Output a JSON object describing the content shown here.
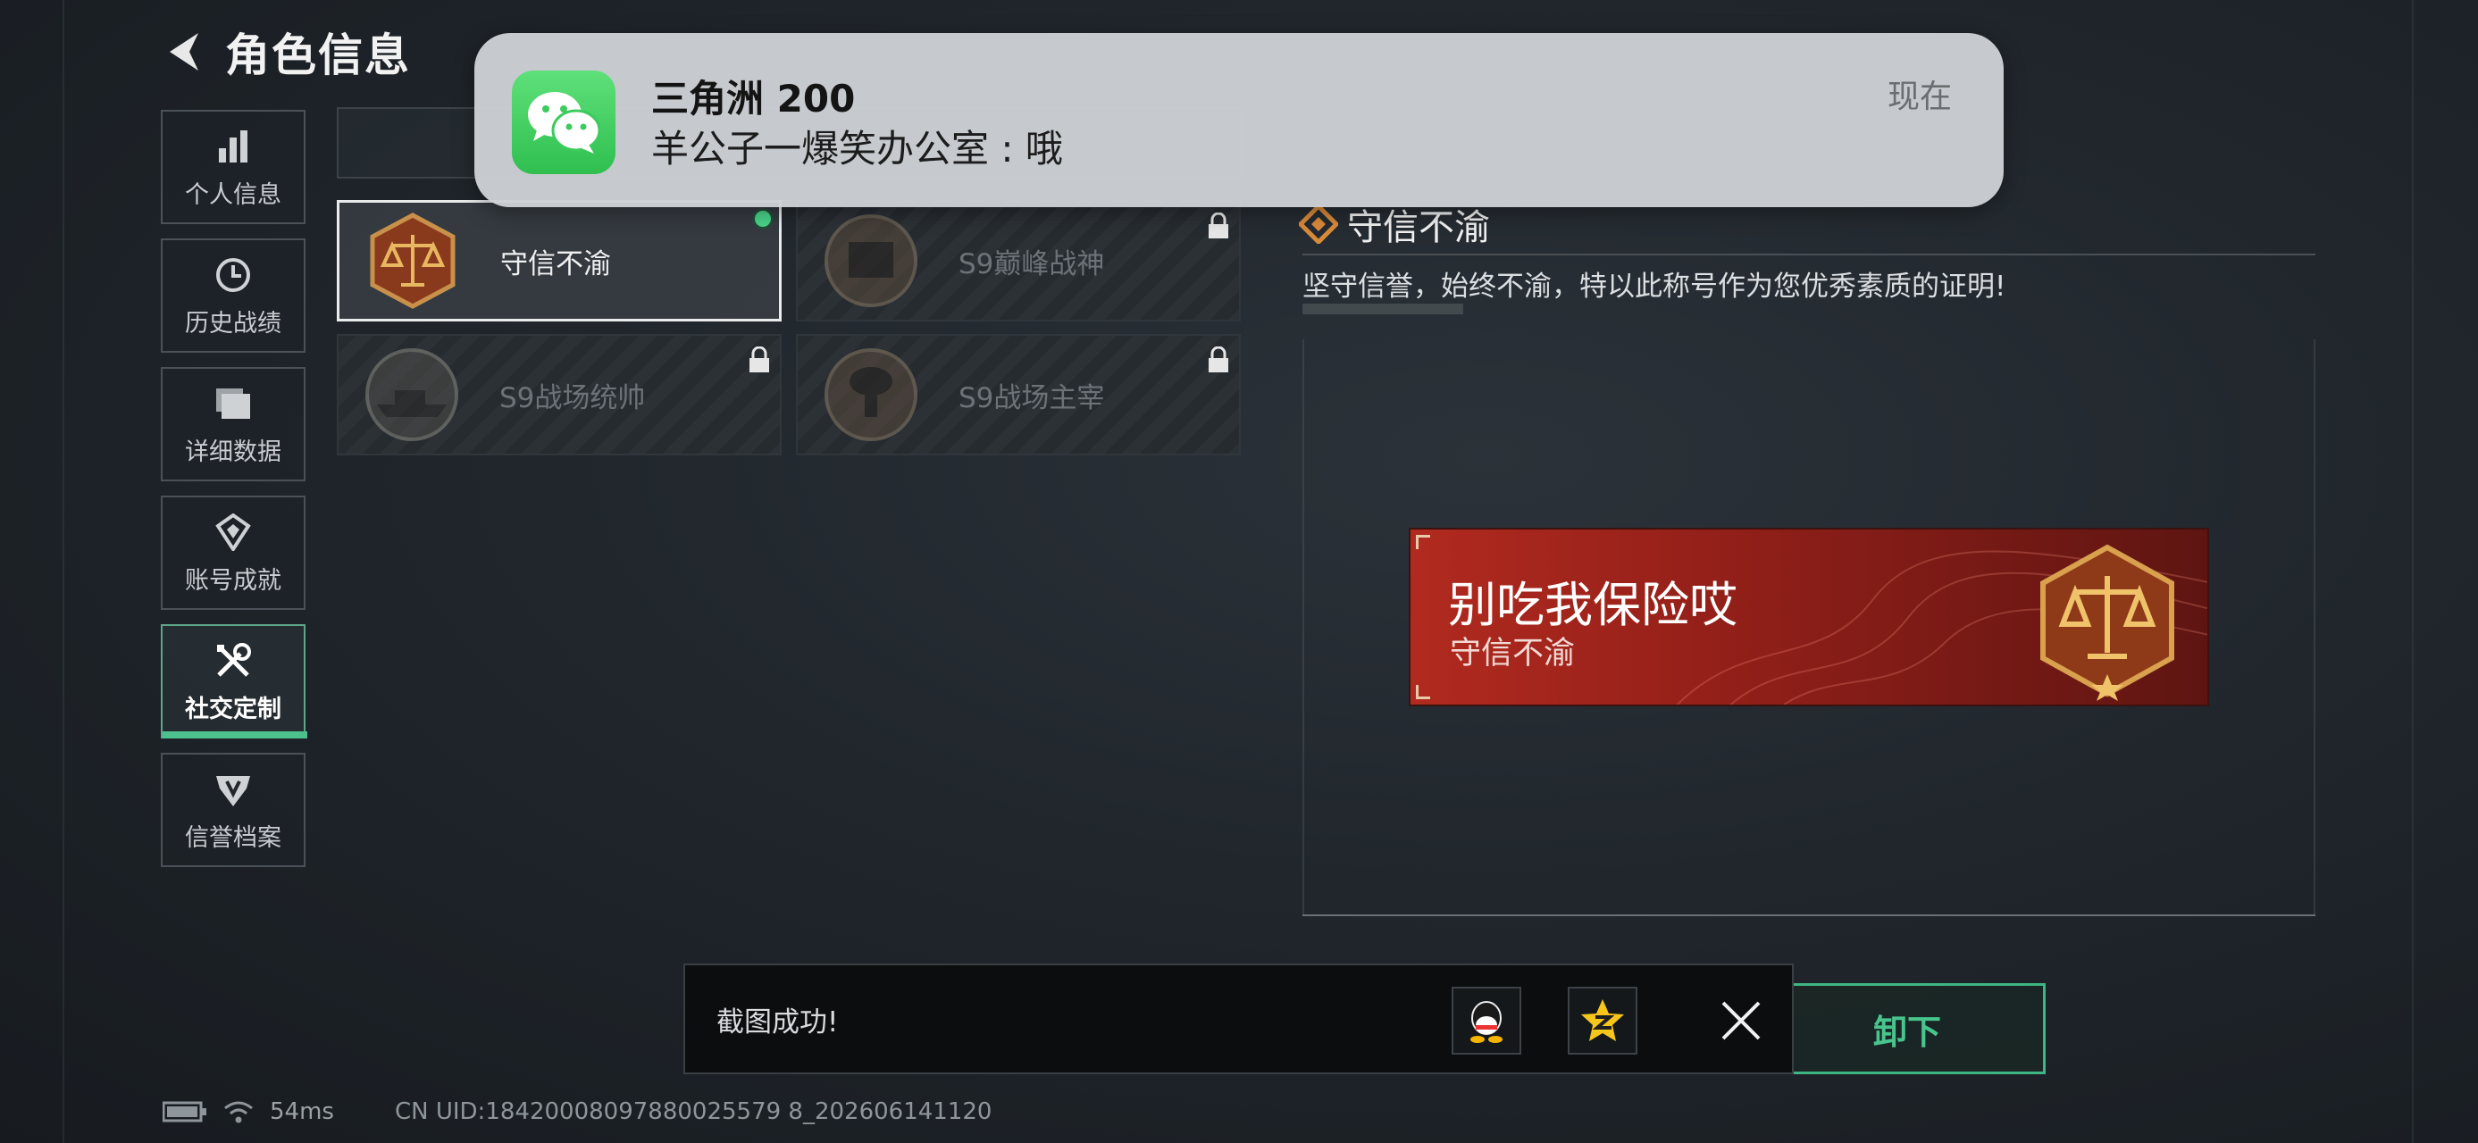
{
  "header": {
    "title": "角色信息"
  },
  "nav": {
    "items": [
      {
        "label": "个人信息",
        "icon": "bar-chart-icon"
      },
      {
        "label": "历史战绩",
        "icon": "clock-icon"
      },
      {
        "label": "详细数据",
        "icon": "folder-icon"
      },
      {
        "label": "账号成就",
        "icon": "achievement-icon"
      },
      {
        "label": "社交定制",
        "icon": "wrench-screwdriver-icon",
        "active": true
      },
      {
        "label": "信誉档案",
        "icon": "shield-emblem-icon"
      }
    ]
  },
  "titles": {
    "cards": [
      {
        "label": "守信不渝",
        "state": "equipped",
        "icon": "scales-badge-icon"
      },
      {
        "label": "S9巅峰战神",
        "state": "locked",
        "icon": "fortress-badge-icon"
      },
      {
        "label": "S9战场统帅",
        "state": "locked",
        "icon": "battleship-badge-icon"
      },
      {
        "label": "S9战场主宰",
        "state": "locked",
        "icon": "mushroom-cloud-badge-icon"
      }
    ]
  },
  "detail": {
    "title": "守信不渝",
    "description": "坚守信誉，始终不渝，特以此称号作为您优秀素质的证明!",
    "nameplate": {
      "player_name": "别吃我保险哎",
      "title": "守信不渝"
    },
    "action_label": "卸下"
  },
  "toast": {
    "message": "截图成功!",
    "share_icons": [
      "qq-icon",
      "qzone-icon"
    ]
  },
  "status_bar": {
    "ping": "54ms",
    "uid": "CN UID:18420008097880025579 8_202606141120"
  },
  "notification": {
    "app": "WeChat",
    "title": "三角洲  200",
    "body": "羊公子一爆笑办公室 : 哦",
    "time": "现在"
  },
  "colors": {
    "accent_green": "#4cc18e",
    "nameplate_red": "#b12a1f",
    "toast_bg": "#0b0d0f"
  }
}
